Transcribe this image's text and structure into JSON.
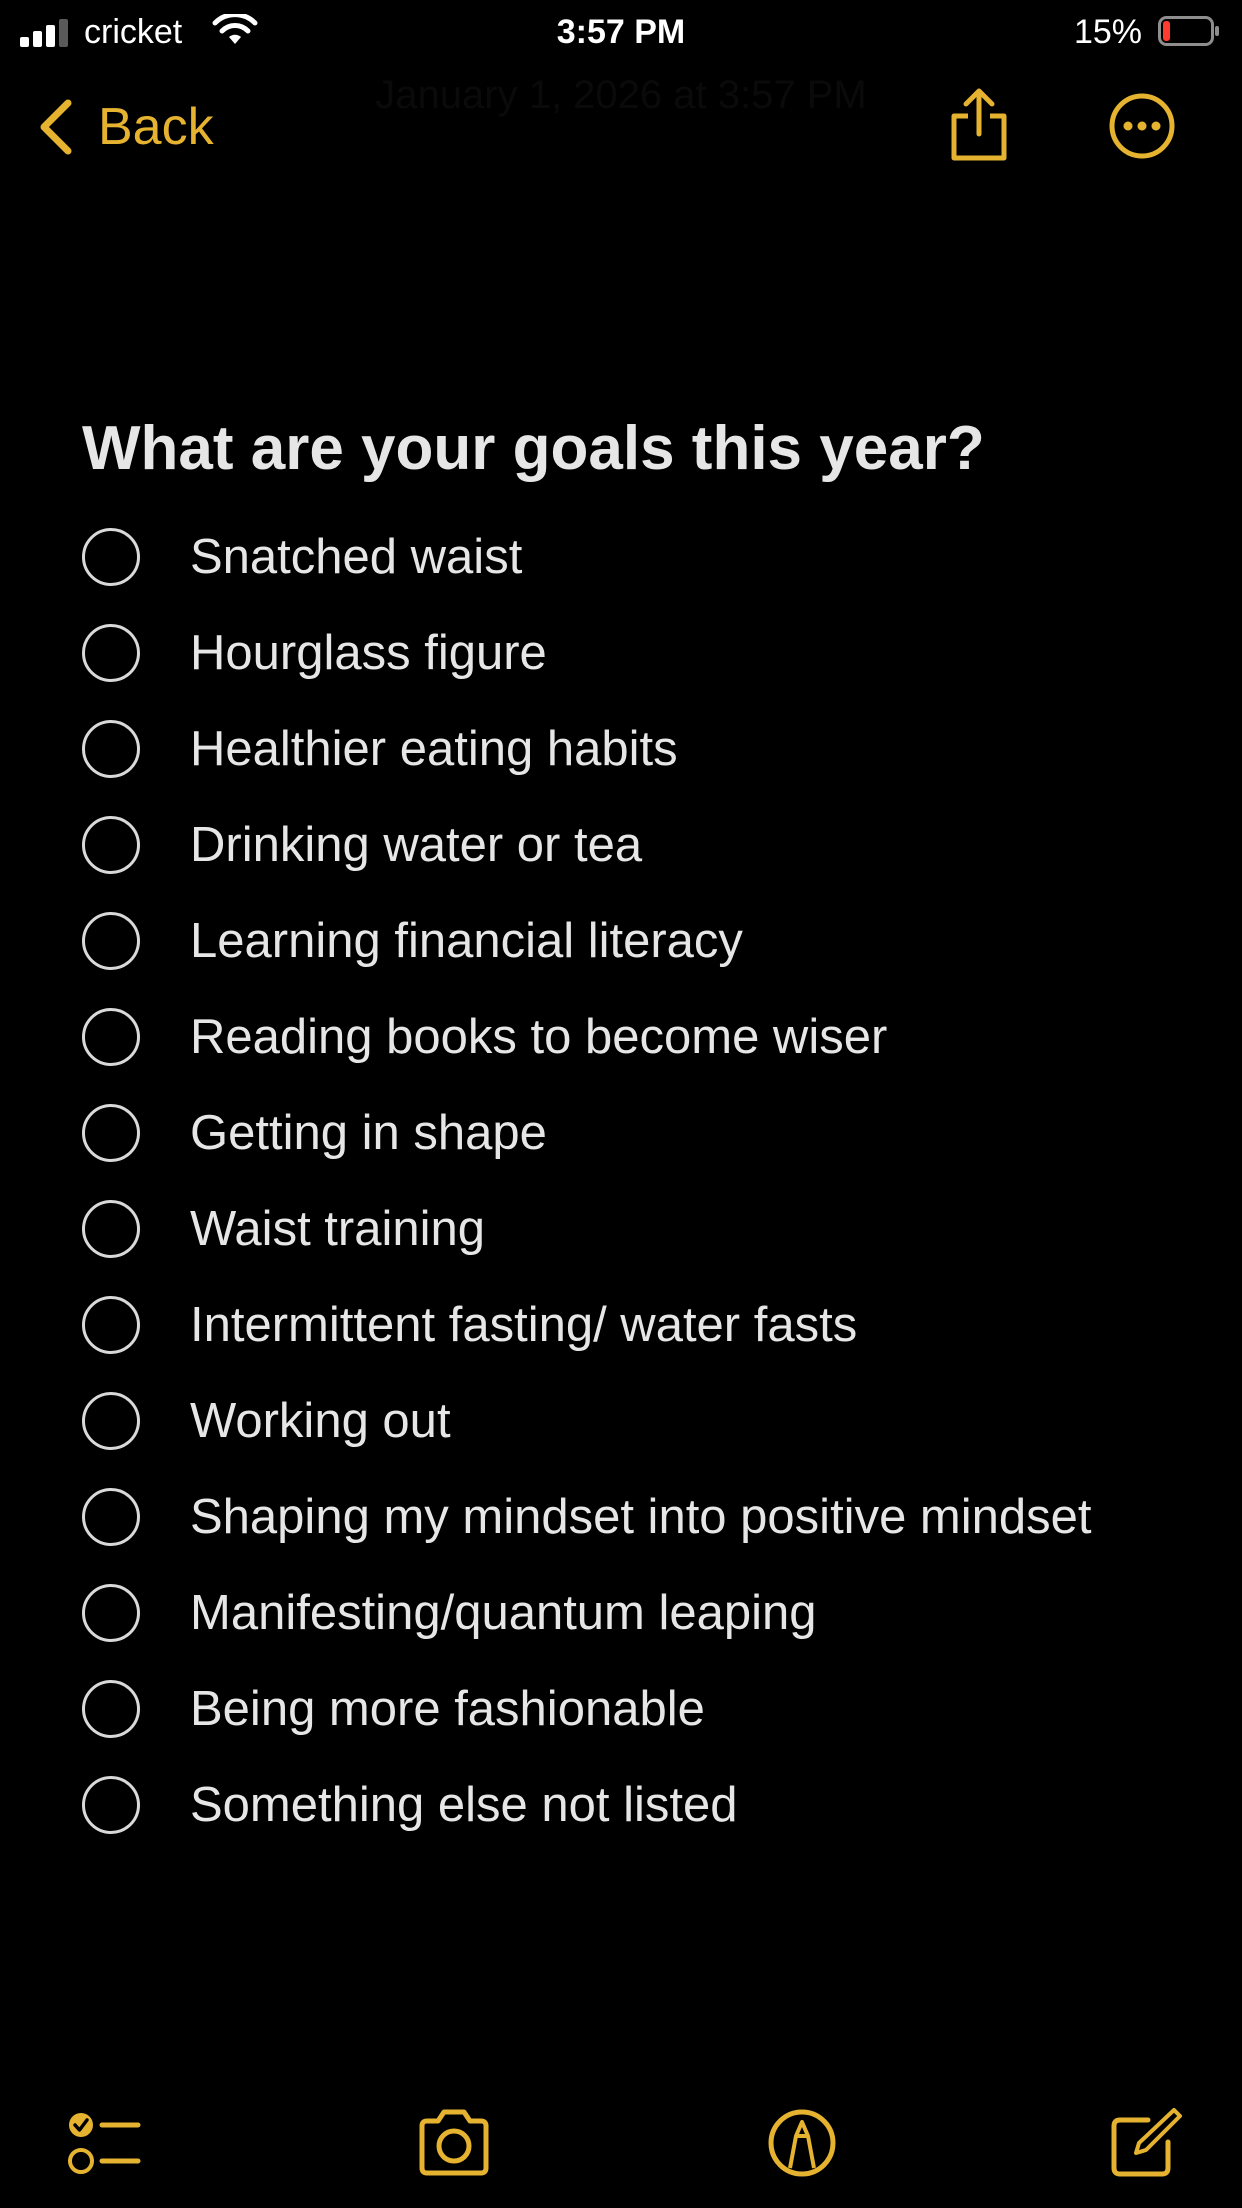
{
  "status_bar": {
    "carrier": "cricket",
    "time": "3:57 PM",
    "battery_percent": "15%",
    "battery_level": 0.15,
    "signal_bars_active": 3,
    "signal_bars_total": 4
  },
  "nav": {
    "back_label": "Back",
    "date_text": "January 1, 2026 at 3:57 PM",
    "share_icon": "share-icon",
    "more_icon": "ellipsis-circle-icon"
  },
  "note": {
    "title": "What are your goals this year?",
    "items": [
      {
        "label": "Snatched waist",
        "checked": false
      },
      {
        "label": "Hourglass figure",
        "checked": false
      },
      {
        "label": "Healthier eating habits",
        "checked": false
      },
      {
        "label": "Drinking water or tea",
        "checked": false
      },
      {
        "label": "Learning financial literacy",
        "checked": false
      },
      {
        "label": "Reading books to become wiser",
        "checked": false
      },
      {
        "label": "Getting in shape",
        "checked": false
      },
      {
        "label": "Waist training",
        "checked": false
      },
      {
        "label": "Intermittent fasting/ water fasts",
        "checked": false
      },
      {
        "label": "Working out",
        "checked": false
      },
      {
        "label": "Shaping my mindset into positive mindset",
        "checked": false
      },
      {
        "label": "Manifesting/quantum leaping",
        "checked": false
      },
      {
        "label": "Being more fashionable",
        "checked": false
      },
      {
        "label": "Something else not listed",
        "checked": false
      }
    ]
  },
  "toolbar": {
    "icons": [
      "checklist-icon",
      "camera-icon",
      "markup-pen-icon",
      "compose-icon"
    ]
  },
  "colors": {
    "accent": "#e5b32f",
    "background": "#000000",
    "text": "#e6e6e6",
    "battery_low": "#ff3b30"
  }
}
